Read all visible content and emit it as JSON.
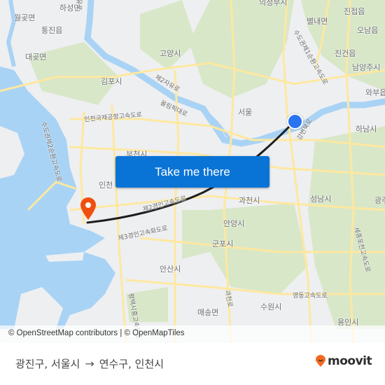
{
  "map": {
    "labels": [
      {
        "text": "하성면",
        "kind": "place"
      },
      {
        "text": "월곶면",
        "kind": "place"
      },
      {
        "text": "통진읍",
        "kind": "place"
      },
      {
        "text": "대곶면",
        "kind": "place"
      },
      {
        "text": "김포시",
        "kind": "place"
      },
      {
        "text": "고양시",
        "kind": "place"
      },
      {
        "text": "의정부시",
        "kind": "place"
      },
      {
        "text": "별내면",
        "kind": "place"
      },
      {
        "text": "진접읍",
        "kind": "place"
      },
      {
        "text": "오남읍",
        "kind": "place"
      },
      {
        "text": "진건읍",
        "kind": "place"
      },
      {
        "text": "남양주시",
        "kind": "place"
      },
      {
        "text": "와부읍",
        "kind": "place"
      },
      {
        "text": "서울",
        "kind": "place"
      },
      {
        "text": "하남시",
        "kind": "place"
      },
      {
        "text": "부천시",
        "kind": "place"
      },
      {
        "text": "인천",
        "kind": "place"
      },
      {
        "text": "과천시",
        "kind": "place"
      },
      {
        "text": "성남시",
        "kind": "place"
      },
      {
        "text": "안양시",
        "kind": "place"
      },
      {
        "text": "군포시",
        "kind": "place"
      },
      {
        "text": "안산시",
        "kind": "place"
      },
      {
        "text": "수원시",
        "kind": "place"
      },
      {
        "text": "매송면",
        "kind": "place"
      },
      {
        "text": "용인시",
        "kind": "place"
      },
      {
        "text": "광주",
        "kind": "place"
      },
      {
        "text": "자유로",
        "kind": "road"
      },
      {
        "text": "제2자유로",
        "kind": "road"
      },
      {
        "text": "올림픽대로",
        "kind": "road"
      },
      {
        "text": "인천국제공항고속도로",
        "kind": "road"
      },
      {
        "text": "수도권제2순환고속도로",
        "kind": "road"
      },
      {
        "text": "수도권제1순환고속도로",
        "kind": "road"
      },
      {
        "text": "제2경인고속도로",
        "kind": "road"
      },
      {
        "text": "제3경인고속화도로",
        "kind": "road"
      },
      {
        "text": "영동고속도로",
        "kind": "road"
      },
      {
        "text": "세종포천고속도로",
        "kind": "road"
      },
      {
        "text": "강변북로",
        "kind": "road"
      },
      {
        "text": "과천로",
        "kind": "road"
      },
      {
        "text": "평택시흥고속도로",
        "kind": "road"
      }
    ],
    "attribution": "© OpenStreetMap contributors | © OpenMapTiles",
    "cta_label": "Take me there",
    "colors": {
      "water": "#a9d3f5",
      "land": "#eeeff1",
      "green": "#d6e6c6",
      "road": "#fde8a0",
      "route": "#1e1e1e",
      "origin": "#2a74f0",
      "destination": "#f0500f",
      "cta": "#0a74d6"
    }
  },
  "footer": {
    "origin": "광진구, 서울시",
    "arrow": "→",
    "destination": "연수구, 인천시",
    "brand": "moovit",
    "brand_color": "#f26a21"
  }
}
